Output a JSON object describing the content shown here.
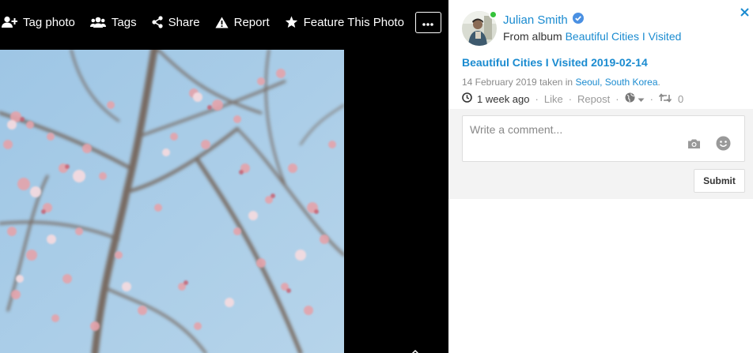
{
  "toolbar": {
    "tag_photo": "Tag photo",
    "tags": "Tags",
    "share": "Share",
    "report": "Report",
    "feature": "Feature This Photo",
    "more": "•••"
  },
  "photo": {
    "description": "cherry blossom branches"
  },
  "panel": {
    "user_name": "Julian Smith",
    "from_prefix": "From album",
    "album_name": "Beautiful Cities I Visited",
    "photo_title": "Beautiful Cities I Visited 2019-02-14",
    "date_text": "14 February 2019 taken in",
    "location": "Seoul, South Korea",
    "location_suffix": ".",
    "time_ago": "1 week ago",
    "like": "Like",
    "repost": "Repost",
    "repost_count": "0",
    "comment_placeholder": "Write a comment...",
    "submit": "Submit"
  },
  "colors": {
    "link": "#1a8bd0",
    "online": "#35c23a",
    "verified": "#4a90e2",
    "viewer_bg": "#000000"
  }
}
